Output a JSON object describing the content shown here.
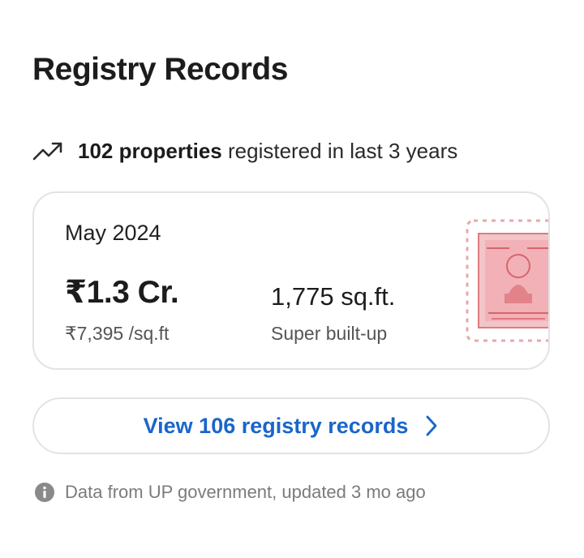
{
  "header": {
    "title": "Registry Records"
  },
  "summary": {
    "icon": "trending-up-icon",
    "count_text": "102 properties",
    "rest_text": "registered in last 3 years"
  },
  "record": {
    "date": "May 2024",
    "price": "₹1.3 Cr.",
    "rate": "₹7,395 /sq.ft",
    "area": "1,775 sq.ft.",
    "area_type": "Super built-up",
    "stamp_icon": "stamp-paper-icon",
    "stamp_color": "#e07b82"
  },
  "cta": {
    "label": "View 106 registry records",
    "icon": "chevron-right-icon",
    "color": "#1a66c9"
  },
  "footer": {
    "icon": "info-icon",
    "text": "Data from UP government, updated 3 mo ago"
  }
}
